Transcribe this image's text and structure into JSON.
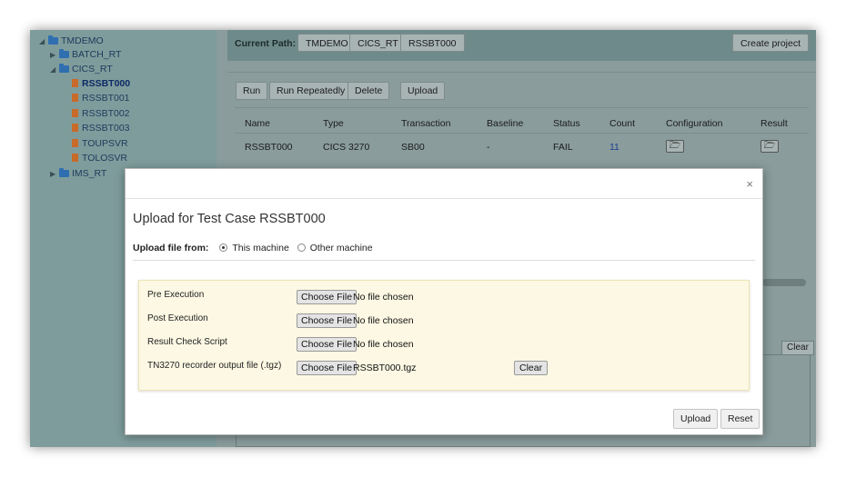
{
  "tree": {
    "root": "TMDEMO",
    "items": [
      {
        "label": "BATCH_RT",
        "kind": "folder"
      },
      {
        "label": "CICS_RT",
        "kind": "folder"
      },
      {
        "label": "RSSBT000",
        "kind": "file",
        "selected": true
      },
      {
        "label": "RSSBT001",
        "kind": "file"
      },
      {
        "label": "RSSBT002",
        "kind": "file"
      },
      {
        "label": "RSSBT003",
        "kind": "file"
      },
      {
        "label": "TOUPSVR",
        "kind": "file"
      },
      {
        "label": "TOLOSVR",
        "kind": "file"
      },
      {
        "label": "IMS_RT",
        "kind": "folder"
      }
    ]
  },
  "path_bar": {
    "label": "Current Path:",
    "crumbs": [
      "TMDEMO",
      "CICS_RT",
      "RSSBT000"
    ],
    "create_label": "Create project"
  },
  "actions": {
    "run": "Run",
    "run_repeatedly": "Run Repeatedly",
    "delete": "Delete",
    "upload": "Upload"
  },
  "table": {
    "headers": [
      "Name",
      "Type",
      "Transaction",
      "Baseline",
      "Status",
      "Count",
      "Configuration",
      "Result"
    ],
    "row": {
      "name": "RSSBT000",
      "type": "CICS 3270",
      "transaction": "SB00",
      "baseline": "-",
      "status": "FAIL",
      "count": "11"
    }
  },
  "log": {
    "clear_label": "Clear"
  },
  "modal": {
    "close": "×",
    "title": "Upload for Test Case RSSBT000",
    "upload_from_label": "Upload file from:",
    "option_this": "This machine",
    "option_other": "Other machine",
    "files": [
      {
        "label": "Pre Execution",
        "button": "Choose File",
        "status": "No file chosen"
      },
      {
        "label": "Post Execution",
        "button": "Choose File",
        "status": "No file chosen"
      },
      {
        "label": "Result Check Script",
        "button": "Choose File",
        "status": "No file chosen"
      },
      {
        "label": "TN3270 recorder output file (.tgz)",
        "button": "Choose File",
        "status": "RSSBT000.tgz"
      }
    ],
    "clear_label": "Clear",
    "upload_label": "Upload",
    "reset_label": "Reset"
  },
  "colors": {
    "overlay_teal": "#8a9c9c",
    "file_box_bg": "#fcf8e3",
    "link_blue": "#1a3f8f",
    "file_icon": "#c86a2a",
    "folder_icon": "#2f6fb0"
  }
}
